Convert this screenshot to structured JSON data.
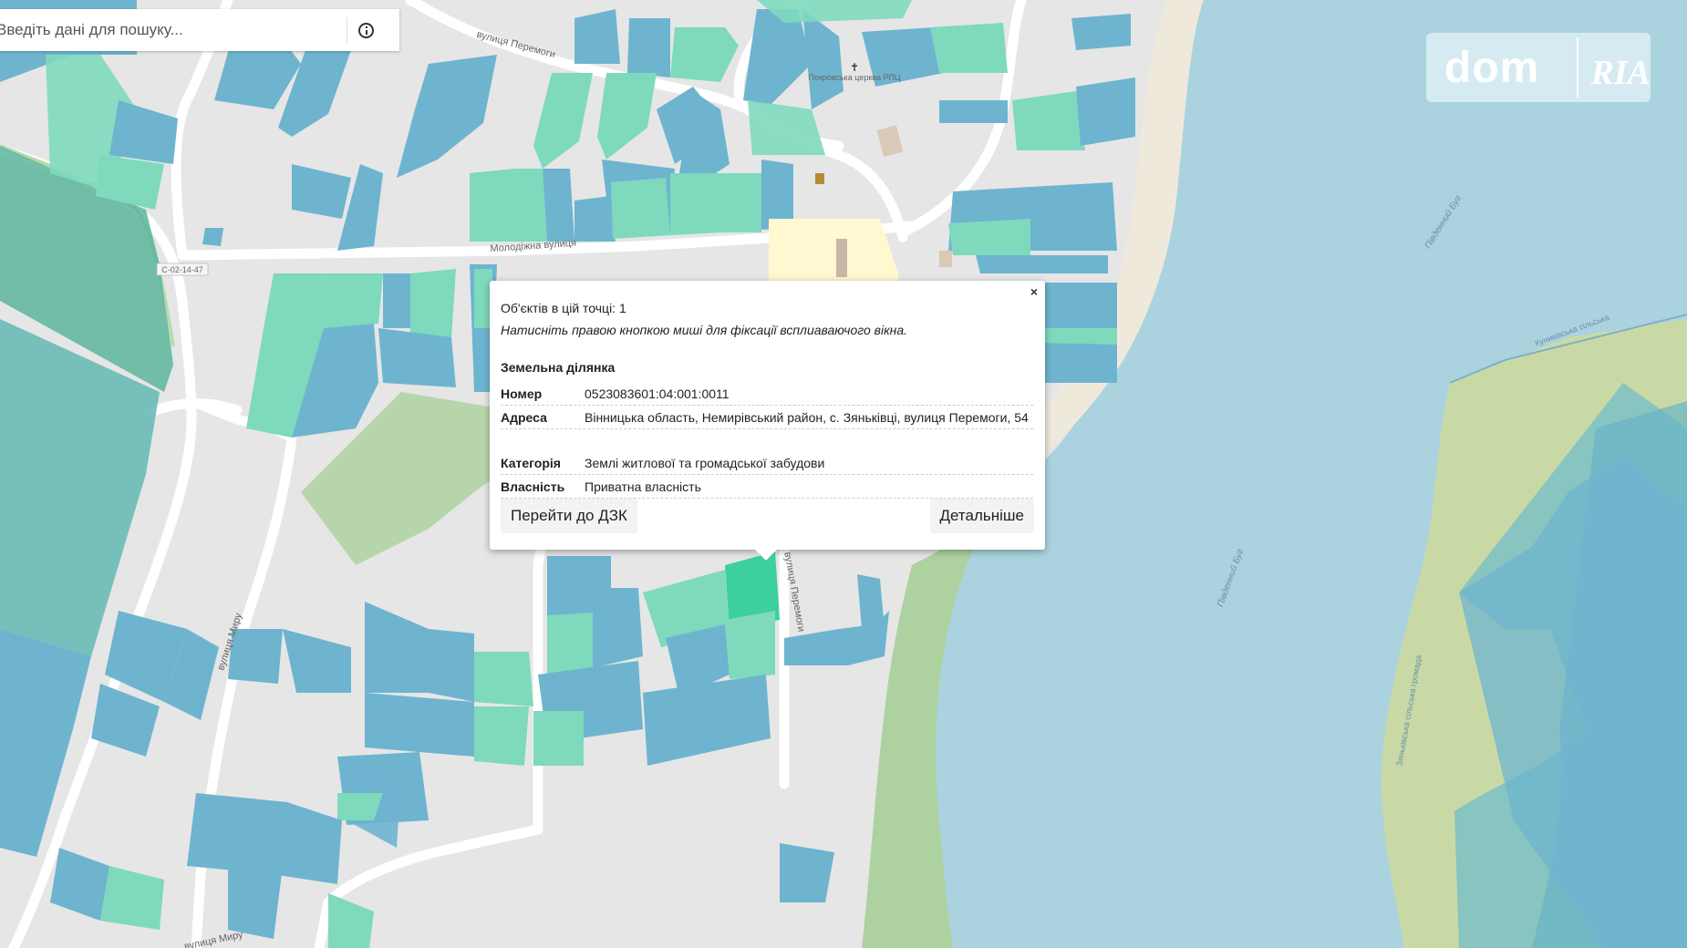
{
  "search": {
    "placeholder": "Введіть дані для пошуку..."
  },
  "logo": {
    "dom": "dom",
    "ria": "RIA"
  },
  "map": {
    "labels": {
      "street_peremohy_top": "вулиця Перемоги",
      "street_molodizhna": "Молодіжна вулиця",
      "road_code": "С-02-14-47",
      "street_myru_left": "вулиця Миру",
      "street_peremohy_mid": "вулиця Перемоги",
      "street_myru_bottom": "вулиця Миру",
      "church": "Покровська церква РПЦ",
      "water_1": "Південний Буг",
      "water_2": "Південний Буг",
      "boundary_1": "Куниківська сільська",
      "boundary_2": "Зяньківська сільська громада"
    },
    "colors": {
      "background": "#e6e6e6",
      "water": "#aad3df",
      "parcel_blue": "#6eb4cf",
      "parcel_green": "#7ed9bd",
      "forest": "#aed1a0",
      "selected": "#3ccfa0"
    }
  },
  "popup": {
    "close_label": "×",
    "count_text": "Об'єктів в цій точці: 1",
    "hint_text": "Натисніть правою кнопкою миші для фіксації всплиаваючого вікна.",
    "section_title": "Земельна ділянка",
    "rows": [
      {
        "key": "Номер",
        "value": "0523083601:04:001:0011"
      },
      {
        "key": "Адреса",
        "value": "Вінницька область, Немирівський район, с. Зяньківці, вулиця Перемоги, 54"
      },
      {
        "key": "Категорія",
        "value": "Землі житлової та громадської забудови"
      },
      {
        "key": "Власність",
        "value": "Приватна власність"
      }
    ],
    "buttons": {
      "goto": "Перейти до ДЗК",
      "details": "Детальніше"
    }
  }
}
